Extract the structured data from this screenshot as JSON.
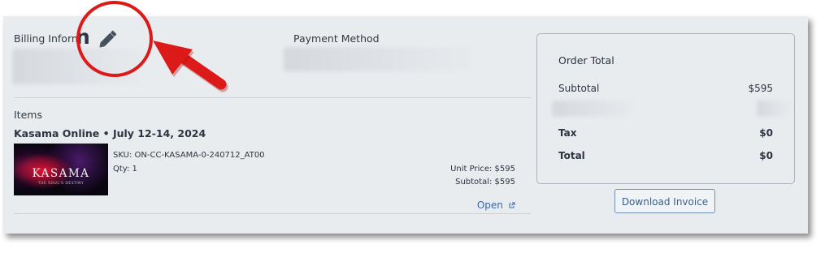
{
  "billing": {
    "title": "Billing Inforn",
    "title_overlay": "n",
    "edit_icon": "pencil-icon"
  },
  "payment": {
    "title": "Payment Method"
  },
  "items": {
    "section_title": "Items",
    "event": {
      "title": "Kasama Online • July 12-14, 2024",
      "image_title": "KASAMA",
      "image_tagline": "THE SOUL'S DESTINY",
      "sku_label": "SKU:",
      "sku": "ON-CC-KASAMA-0-240712_AT00",
      "qty_label": "Qty:",
      "qty": "1",
      "unit_price": "Unit Price: $595",
      "subtotal": "Subtotal: $595",
      "open_link": "Open",
      "open_icon": "external-link-icon"
    }
  },
  "order_total": {
    "title": "Order Total",
    "subtotal_label": "Subtotal",
    "subtotal_value": "$595",
    "tax_label": "Tax",
    "tax_value": "$0",
    "total_label": "Total",
    "total_value": "$0"
  },
  "download_button": "Download Invoice",
  "annotation": {
    "color": "#dd1a1a",
    "shapes": [
      "red-circle-highlight",
      "red-arrow"
    ]
  }
}
